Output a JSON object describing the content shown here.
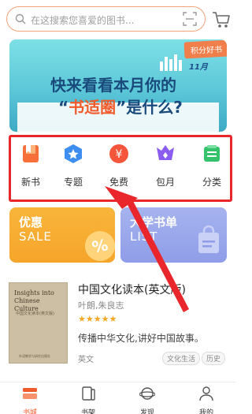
{
  "search": {
    "placeholder": "在这搜索您喜爱的图书..."
  },
  "banner": {
    "badge": "积分好书",
    "month": "11月",
    "line1": "快来看看本月你的",
    "line2_open": "“",
    "line2_highlight": "书适圈",
    "line2_close": "”是什么?"
  },
  "categories": [
    {
      "label": "新书",
      "icon": "new-book-icon"
    },
    {
      "label": "专题",
      "icon": "topic-icon"
    },
    {
      "label": "免费",
      "icon": "free-icon"
    },
    {
      "label": "包月",
      "icon": "monthly-icon"
    },
    {
      "label": "分类",
      "icon": "category-icon"
    }
  ],
  "promos": {
    "left": {
      "title": "优惠",
      "subtitle": "SALE",
      "badge": "%"
    },
    "right": {
      "title": "大学书单",
      "subtitle": "LIST"
    }
  },
  "book": {
    "cover_title": "Insights into Chinese Culture",
    "cover_subtitle": "中国文化读本(英文版)",
    "cover_publisher": "外语教学与研究出版社",
    "title": "中国文化读本(英文版)",
    "author": "叶朗,朱良志",
    "stars": "★★★★★",
    "rating": 5,
    "description": "传播中华文化,讲好中国故事。",
    "category": "英文",
    "tags": [
      "文化生活",
      "历史"
    ]
  },
  "nav": [
    {
      "label": "书城",
      "icon": "bookstore-icon",
      "active": true
    },
    {
      "label": "书架",
      "icon": "bookshelf-icon",
      "active": false
    },
    {
      "label": "发现",
      "icon": "discover-icon",
      "active": false
    },
    {
      "label": "我的",
      "icon": "profile-icon",
      "active": false
    }
  ],
  "colors": {
    "accent": "#f15a2b",
    "highlight_border": "#e8262b",
    "star": "#f5a623"
  }
}
